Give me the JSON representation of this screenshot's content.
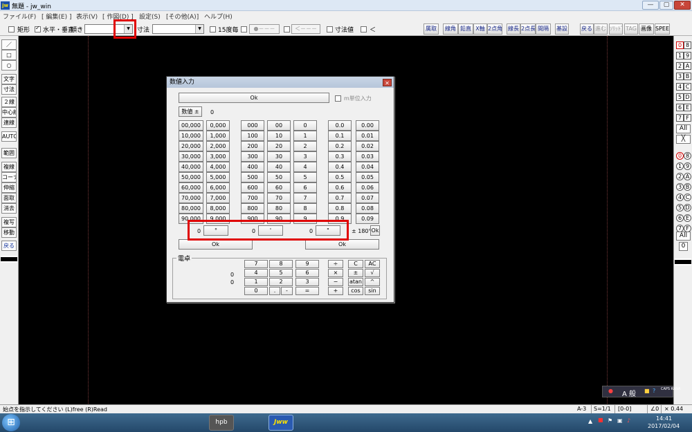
{
  "window": {
    "app_icon": "jw",
    "title": "無題 - jw_win",
    "min": "—",
    "max": "▢",
    "close": "✕"
  },
  "menu": [
    "ファイル(F)",
    "[ 編集(E) ]",
    "表示(V)",
    "[ 作図(D) ]",
    "設定(S)",
    "[その他(A)]",
    "ヘルプ(H)"
  ],
  "toolbar": {
    "rect_label": "矩形",
    "hv_label": "水平・垂直",
    "tilt_label": "傾き",
    "dim_label": "寸法",
    "deg15_label": "15度毎",
    "dot_seg": "●－－－",
    "arrow_seg": "＜－－－",
    "dimval_label": "寸法値",
    "lt_label": "＜",
    "buttons_right": [
      "属取",
      "線角",
      "鉛直",
      "X軸",
      "2点角",
      "線長",
      "2点長",
      "間隔",
      "基設"
    ],
    "buttons_right2": [
      "戻る",
      "進む",
      "ｿﾘｯﾄﾞ",
      "TAG",
      "画像",
      "SPEED"
    ]
  },
  "left_tools": [
    "／",
    "□",
    "○",
    "文字",
    "寸法",
    "２線",
    "中心線",
    "連線",
    "AUTO",
    "範囲",
    "複線",
    "コーナー",
    "伸縮",
    "面取",
    "消去",
    "複写",
    "移動",
    "戻る"
  ],
  "right_layers": {
    "group1": [
      [
        "0",
        "8"
      ],
      [
        "1",
        "9"
      ],
      [
        "2",
        "A"
      ],
      [
        "3",
        "B"
      ],
      [
        "4",
        "C"
      ],
      [
        "5",
        "D"
      ],
      [
        "6",
        "E"
      ],
      [
        "7",
        "F"
      ]
    ],
    "all1": "All",
    "x": "╳",
    "group2": [
      [
        "0",
        "8"
      ],
      [
        "1",
        "9"
      ],
      [
        "2",
        "A"
      ],
      [
        "3",
        "B"
      ],
      [
        "4",
        "C"
      ],
      [
        "5",
        "D"
      ],
      [
        "6",
        "E"
      ],
      [
        "7",
        "F"
      ]
    ],
    "all2": "All",
    "zero": "0"
  },
  "dialog": {
    "title": "数値入力",
    "close": "✕",
    "ok_top": "Ok",
    "m_unit": "m単位入力",
    "sign_btn": "数値 ±",
    "value": "0",
    "grid": [
      [
        "00,000",
        "0,000",
        "000",
        "00",
        "0",
        "0.0",
        "0.00"
      ],
      [
        "10,000",
        "1,000",
        "100",
        "10",
        "1",
        "0.1",
        "0.01"
      ],
      [
        "20,000",
        "2,000",
        "200",
        "20",
        "2",
        "0.2",
        "0.02"
      ],
      [
        "30,000",
        "3,000",
        "300",
        "30",
        "3",
        "0.3",
        "0.03"
      ],
      [
        "40,000",
        "4,000",
        "400",
        "40",
        "4",
        "0.4",
        "0.04"
      ],
      [
        "50,000",
        "5,000",
        "500",
        "50",
        "5",
        "0.5",
        "0.05"
      ],
      [
        "60,000",
        "6,000",
        "600",
        "60",
        "6",
        "0.6",
        "0.06"
      ],
      [
        "70,000",
        "7,000",
        "700",
        "70",
        "7",
        "0.7",
        "0.07"
      ],
      [
        "80,000",
        "8,000",
        "800",
        "80",
        "8",
        "0.8",
        "0.08"
      ],
      [
        "90,000",
        "9,000",
        "900",
        "90",
        "9",
        "0.9",
        "0.09"
      ]
    ],
    "deg_val": "0",
    "deg_btn": "°",
    "min_val": "0",
    "min_btn": "'",
    "sec_val": "0",
    "sec_btn": "\"",
    "pm180": "± 180°",
    "ok_small": "Ok",
    "ok_left": "Ok",
    "ok_right": "Ok",
    "calc_label": "電卓",
    "calc_val1": "0",
    "calc_val2": "0",
    "calc_rows": [
      [
        "7",
        "8",
        "9",
        "÷",
        "C",
        "AC"
      ],
      [
        "4",
        "5",
        "6",
        "×",
        "±",
        "√"
      ],
      [
        "1",
        "2",
        "3",
        "−",
        "atan",
        "^"
      ],
      [
        "0",
        ".",
        "-",
        "=",
        "+",
        "cos",
        "sin"
      ]
    ]
  },
  "status": {
    "msg": "始点を指示してください (L)free (R)Read",
    "layer": "A-3",
    "scale": "S=1/1",
    "grp": "[0-0]",
    "angle": "∠0",
    "ratio": "× 0.44"
  },
  "taskbar": {
    "apps": [
      "",
      "",
      "",
      "",
      "",
      "",
      "hpb",
      "",
      "Jww"
    ],
    "time": "14:41",
    "date": "2017/02/04"
  },
  "floatpanel": {
    "ime": "A 般",
    "help": "?",
    "caps": "CAPS KANA"
  }
}
